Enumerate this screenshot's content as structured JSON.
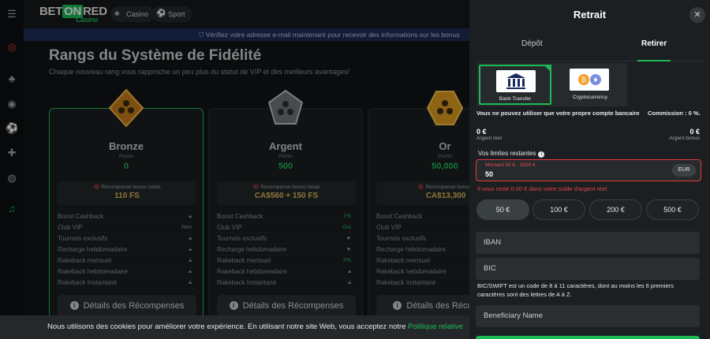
{
  "header": {
    "logo_bet": "BET",
    "logo_on": "ON",
    "logo_red": "RED",
    "logo_tagline": "Casino",
    "pill_casino": "Casino",
    "pill_sport": "Sport"
  },
  "banner": {
    "text": "Vérifiez votre adresse e-mail maintenant pour recevoir des informations sur les bonus"
  },
  "main": {
    "title": "Rangs du Système de Fidélité",
    "subtitle": "Chaque nouveau rang vous rapproche un peu plus du statut de VIP et des meilleurs avantages!"
  },
  "cards": [
    {
      "rank": "Bronze",
      "points_label": "Points",
      "points": "0",
      "bonus_label": "Récompense bonus totale",
      "bonus_value": "110 FS",
      "rows": [
        {
          "label": "Boost Cashback",
          "value": ""
        },
        {
          "label": "Club VIP",
          "value": "Non"
        },
        {
          "label": "Tournois exclusifs",
          "value": ""
        },
        {
          "label": "Recharge hebdomadaire",
          "value": ""
        },
        {
          "label": "Rakeback mensuel",
          "value": ""
        },
        {
          "label": "Rakeback hebdomadaire",
          "value": ""
        },
        {
          "label": "Rakeback Instantané",
          "value": ""
        }
      ],
      "button": "Détails des Récompenses"
    },
    {
      "rank": "Argent",
      "points_label": "Points",
      "points": "500",
      "bonus_label": "Récompense bonus totale",
      "bonus_value": "CA$560 + 150 FS",
      "rows": [
        {
          "label": "Boost Cashback",
          "value": "1%"
        },
        {
          "label": "Club VIP",
          "value": "Oui"
        },
        {
          "label": "Tournois exclusifs",
          "value": "★"
        },
        {
          "label": "Recharge hebdomadaire",
          "value": "★"
        },
        {
          "label": "Rakeback mensuel",
          "value": "2%"
        },
        {
          "label": "Rakeback hebdomadaire",
          "value": ""
        },
        {
          "label": "Rakeback Instantané",
          "value": ""
        }
      ],
      "button": "Détails des Récompenses"
    },
    {
      "rank": "Or",
      "points_label": "Points",
      "points": "50,000",
      "bonus_label": "Récompense bonus t",
      "bonus_value": "CA$13,300",
      "rows": [
        {
          "label": "Boost Cashback",
          "value": ""
        },
        {
          "label": "Club VIP",
          "value": ""
        },
        {
          "label": "Tournois exclusifs",
          "value": ""
        },
        {
          "label": "Recharge hebdomadaire",
          "value": ""
        },
        {
          "label": "Rakeback mensuel",
          "value": ""
        },
        {
          "label": "Rakeback hebdomadaire",
          "value": ""
        },
        {
          "label": "Rakeback Instantané",
          "value": ""
        }
      ],
      "button": "Détails des Récompens"
    }
  ],
  "cookie": {
    "text": "Nous utilisons des cookies pour améliorer votre expérience. En utilisant notre site Web, vous acceptez notre ",
    "link": "Politique relative"
  },
  "modal": {
    "title": "Retrait",
    "tab_deposit": "Dépôt",
    "tab_withdraw": "Retirer",
    "method_bank": "Bank Transfer",
    "method_crypto": "Cryptocurrency",
    "note": "Vous ne pouvez utiliser que votre propre compte bancaire",
    "commission": "Commission : 0 %.",
    "real_amount": "0 €",
    "real_label": "Argent réel",
    "bonus_amount": "0 €",
    "bonus_label": "Argent bonus",
    "limits_label": "Vos limites restantes",
    "amount_label": "Montant 50 € - 3000 €",
    "amount_value": "50",
    "currency": "EUR",
    "error": "Il vous reste 0.00 € dans votre solde d'argent réel.",
    "chips": [
      "50 €",
      "100 €",
      "200 €",
      "500 €"
    ],
    "iban_placeholder": "IBAN",
    "bic_placeholder": "BIC",
    "bic_help": "BIC/SWIFT est un code de 8 à 11 caractères, dont au moins les 6 premiers caractères sont des lettres de A à Z.",
    "beneficiary_placeholder": "Beneficiary Name"
  },
  "colors": {
    "accent": "#1db954",
    "error": "#e03b3b",
    "gold": "#d9b65a"
  }
}
